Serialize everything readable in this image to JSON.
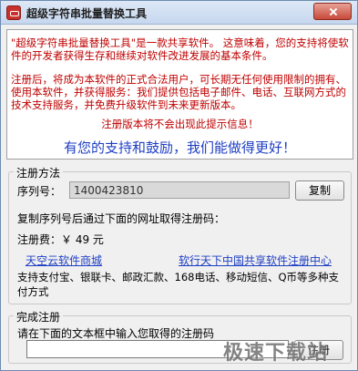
{
  "window": {
    "title": "超级字符串批量替换工具"
  },
  "notice": {
    "paragraph1": "\"超级字符串批量替换工具\"是一款共享软件。 这意味着，您的支持将使软件的开发者获得生存和继续对软件改进发展的基本条件。",
    "paragraph2": "注册后，将成为本软件的正式合法用户，可长期无任何使用限制的拥有、使用本软件，并获得服务：我们提供包括电子邮件、电话、互联网方式的技术支持服务，并免费升级软件到未来更新版本。",
    "reminder": "注册版本将不会出现此提示信息！",
    "slogan": "有您的支持和鼓励，我们能做得更好！",
    "text_color": "#c00000",
    "slogan_color": "#1f3fc4"
  },
  "register_method": {
    "group_label": "注册方法",
    "serial_label": "序列号：",
    "serial_value": "1400423810",
    "copy_button": "复制",
    "instruction": "复制序列号后通过下面的网址取得注册码：",
    "fee_label": "注册费：￥ 49 元",
    "link1": "天空云软件商城",
    "link2": "软行天下中国共享软件注册中心",
    "payment": "支持支付宝、银联卡、邮政汇款、168电话、移动短信、Q币等多种支付方式"
  },
  "complete": {
    "group_label": "完成注册",
    "instruction": "请在下面的文本框中输入您取得的注册码",
    "code_value": "",
    "register_button": "注册"
  },
  "watermark": {
    "text": "极速下载站"
  }
}
